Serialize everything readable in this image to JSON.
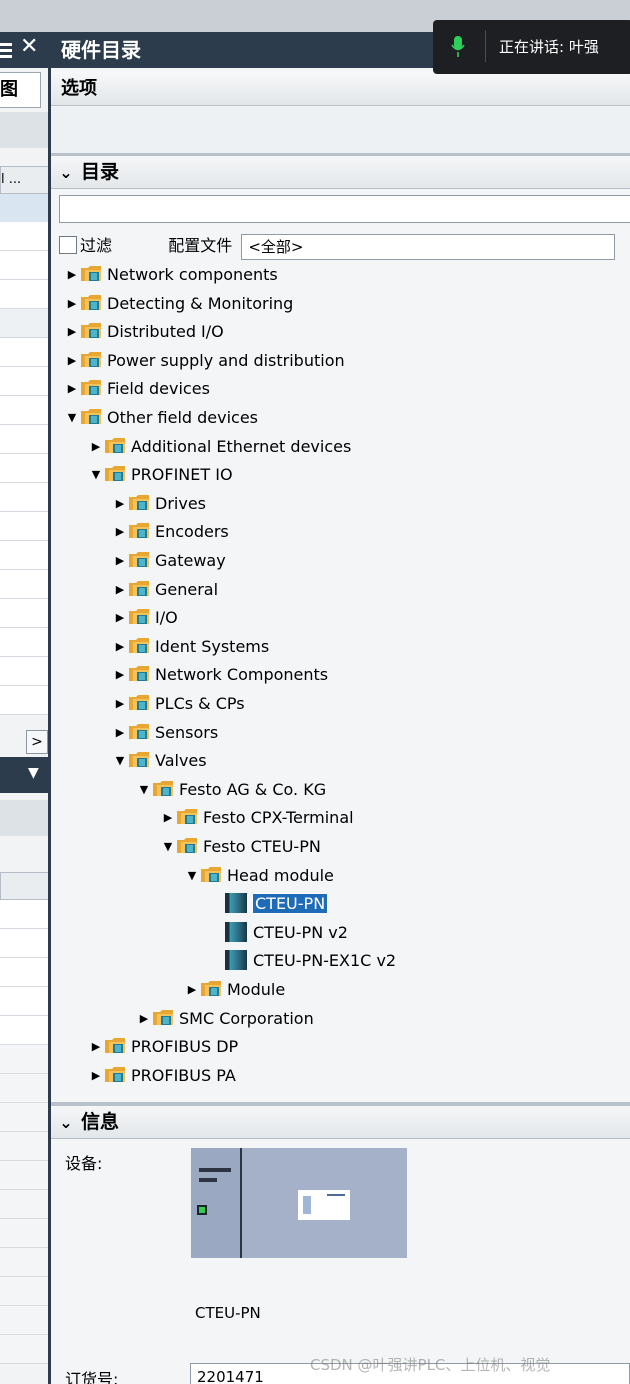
{
  "left_panel": {
    "tab_label": "图",
    "col_header": "l ...",
    "close_glyph": "✕"
  },
  "voice_indicator": {
    "text": "正在讲话: 叶强"
  },
  "pane": {
    "title": "硬件目录",
    "options_label": "选项",
    "catalog_label": "目录",
    "filter_label": "过滤",
    "profile_label": "配置文件",
    "profile_value": "<全部>",
    "search_value": ""
  },
  "tree": [
    {
      "label": "Network components",
      "level": 0,
      "expanded": false,
      "type": "folder"
    },
    {
      "label": "Detecting & Monitoring",
      "level": 0,
      "expanded": false,
      "type": "folder"
    },
    {
      "label": "Distributed I/O",
      "level": 0,
      "expanded": false,
      "type": "folder"
    },
    {
      "label": "Power supply and distribution",
      "level": 0,
      "expanded": false,
      "type": "folder"
    },
    {
      "label": "Field devices",
      "level": 0,
      "expanded": false,
      "type": "folder"
    },
    {
      "label": "Other field devices",
      "level": 0,
      "expanded": true,
      "type": "folder"
    },
    {
      "label": "Additional Ethernet devices",
      "level": 1,
      "expanded": false,
      "type": "folder"
    },
    {
      "label": "PROFINET IO",
      "level": 1,
      "expanded": true,
      "type": "folder"
    },
    {
      "label": "Drives",
      "level": 2,
      "expanded": false,
      "type": "folder"
    },
    {
      "label": "Encoders",
      "level": 2,
      "expanded": false,
      "type": "folder"
    },
    {
      "label": "Gateway",
      "level": 2,
      "expanded": false,
      "type": "folder"
    },
    {
      "label": "General",
      "level": 2,
      "expanded": false,
      "type": "folder"
    },
    {
      "label": "I/O",
      "level": 2,
      "expanded": false,
      "type": "folder"
    },
    {
      "label": "Ident Systems",
      "level": 2,
      "expanded": false,
      "type": "folder"
    },
    {
      "label": "Network Components",
      "level": 2,
      "expanded": false,
      "type": "folder"
    },
    {
      "label": "PLCs & CPs",
      "level": 2,
      "expanded": false,
      "type": "folder"
    },
    {
      "label": "Sensors",
      "level": 2,
      "expanded": false,
      "type": "folder"
    },
    {
      "label": "Valves",
      "level": 2,
      "expanded": true,
      "type": "folder"
    },
    {
      "label": "Festo AG & Co. KG",
      "level": 3,
      "expanded": true,
      "type": "folder"
    },
    {
      "label": "Festo CPX-Terminal",
      "level": 4,
      "expanded": false,
      "type": "folder"
    },
    {
      "label": "Festo CTEU-PN",
      "level": 4,
      "expanded": true,
      "type": "folder"
    },
    {
      "label": "Head module",
      "level": 5,
      "expanded": true,
      "type": "folder"
    },
    {
      "label": "CTEU-PN",
      "level": 6,
      "type": "device",
      "selected": true
    },
    {
      "label": "CTEU-PN v2",
      "level": 6,
      "type": "device"
    },
    {
      "label": "CTEU-PN-EX1C v2",
      "level": 6,
      "type": "device"
    },
    {
      "label": "Module",
      "level": 5,
      "expanded": false,
      "type": "folder"
    },
    {
      "label": "SMC Corporation",
      "level": 3,
      "expanded": false,
      "type": "folder"
    },
    {
      "label": "PROFIBUS DP",
      "level": 1,
      "expanded": false,
      "type": "folder"
    },
    {
      "label": "PROFIBUS PA",
      "level": 1,
      "expanded": false,
      "type": "folder"
    }
  ],
  "info": {
    "section_label": "信息",
    "device_label": "设备:",
    "device_name": "CTEU-PN",
    "order_label": "订货号:",
    "order_number": "2201471"
  },
  "watermark": "CSDN @叶强讲PLC、上位机、视觉",
  "colors": {
    "title_bar": "#2d3c4c",
    "selection": "#1e6bb8",
    "folder": "#e8a632"
  }
}
